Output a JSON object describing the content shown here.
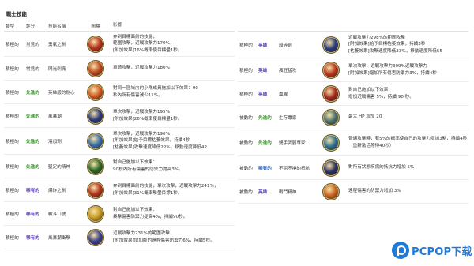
{
  "page_title": "戰士技能",
  "header": {
    "type": "類型",
    "rating": "評分",
    "name": "技能名稱",
    "icon": "圖標",
    "effect": "影響"
  },
  "colors": {
    "green": "#3a9a2a",
    "purple": "#5b3fb6",
    "blue": "#2f64c4"
  },
  "left_rows": [
    {
      "type": "積極的",
      "rating": "常見的",
      "rating_color": "default",
      "name": "勇氣之劍",
      "icon": "sword-slash-icon",
      "icon_color": "#b8321e",
      "lines": [
        "奔到目標面前的技能，",
        "範圍攻擊，近戰攻擊力170%，",
        "[附加效果]16%概率使目標暈1秒。"
      ]
    },
    {
      "type": "積極的",
      "rating": "常見的",
      "rating_color": "default",
      "name": "閃光刺痛",
      "icon": "flash-sting-icon",
      "icon_color": "#c0481f",
      "lines": [
        "單體攻擊，近戰攻擊力180%"
      ]
    },
    {
      "type": "積極的",
      "rating": "先進的",
      "rating_color": "green",
      "name": "英雄般的耐心",
      "icon": "heart-shield-icon",
      "icon_color": "#d25822",
      "lines": [
        "對同一區域內的小隊成員施加以下效果：90",
        "秒內所有傷害減少11%。"
      ]
    },
    {
      "type": "積極的",
      "rating": "先進的",
      "rating_color": "green",
      "name": "風暴潮",
      "icon": "storm-blade-icon",
      "icon_color": "#2c3b7a",
      "lines": [
        "單次攻擊，近戰攻擊力195%",
        "[附加效果]26%概率使目標暈1秒。"
      ]
    },
    {
      "type": "積極的",
      "rating": "先進的",
      "rating_color": "green",
      "name": "溶加劑",
      "icon": "whirl-icon",
      "icon_color": "#3a6fa8",
      "lines": [
        "單次攻擊，近戰攻擊力190%",
        "[附加效果]給予目標枯萎效果，持續4秒",
        "[枯萎效果]攻擊速度降低22%，移動速度降低42"
      ]
    },
    {
      "type": "積極的",
      "rating": "先進的",
      "rating_color": "green",
      "name": "堅定的精神",
      "icon": "spirit-icon",
      "icon_color": "#2d6b2a",
      "lines": [
        "對自己施加以下效果：",
        "90秒內所有傷害的防禦力提高3%。"
      ]
    },
    {
      "type": "積極的",
      "rating": "稀有的",
      "rating_color": "purple",
      "name": "爆炸之劍",
      "icon": "explosion-sword-icon",
      "icon_color": "#b5321c",
      "lines": [
        "奔到目標面前的技能，單次攻擊，近戰攻擊力241%，",
        "[附加效果]31%概率擊暈目標1秒。"
      ]
    },
    {
      "type": "積極的",
      "rating": "稀有的",
      "rating_color": "purple",
      "name": "戰斗口號",
      "icon": "battle-cry-icon",
      "icon_color": "#c99a22",
      "lines": [
        "對自己施加以下效果：",
        "暴擊傷害防禦力提高4%，持續90秒。"
      ]
    },
    {
      "type": "積極的",
      "rating": "稀有的",
      "rating_color": "purple",
      "name": "風暴潮衝擊",
      "icon": "storm-strike-icon",
      "icon_color": "#3b3f8a",
      "lines": [
        "近戰攻擊力231%的範圍攻擊",
        "[附加效果]增加鄰的遠程傷害防禦力6%，持續5秒。"
      ]
    }
  ],
  "right_rows": [
    {
      "type": "積極的",
      "rating": "英雄",
      "rating_color": "purple",
      "name": "殺碎劍",
      "icon": "shatter-blade-icon",
      "icon_color": "#2a3a7c",
      "lines": [
        "近戰攻擊力298%的範圍攻擊",
        "[附加效果]給予目標枯萎效果，持續3秒",
        "[枯萎效果]攻擊速度降低33%，移動速度降低55"
      ]
    },
    {
      "type": "積極的",
      "rating": "英雄",
      "rating_color": "purple",
      "name": "瘋狂猛攻",
      "icon": "frenzy-icon",
      "icon_color": "#b8361f",
      "lines": [
        "單次攻擊，近戰攻擊力309%近戰攻擊力",
        "[附加效果]增加所有傷害防禦力3%，持續4秒"
      ]
    },
    {
      "type": "積極的",
      "rating": "英雄",
      "rating_color": "purple",
      "name": "血腥",
      "icon": "blood-icon",
      "icon_color": "#a3261e",
      "lines": [
        "對自己施加以下效果：",
        "增加近戰傷害 5%，持續 90 秒。"
      ]
    },
    {
      "type": "被動的",
      "rating": "先進的",
      "rating_color": "green",
      "name": "生存專家",
      "icon": "survival-icon",
      "icon_color": "#4c6f6a",
      "lines": [
        "最大 HP 增加 20"
      ]
    },
    {
      "type": "被動的",
      "rating": "先進的",
      "rating_color": "green",
      "name": "雙手武器專家",
      "icon": "twin-weapon-icon",
      "icon_color": "#2e6e90",
      "lines": [
        "普通攻擊時，有5%的概率使自己的攻擊力增加3點，持續4秒",
        "（重新激活等待40秒）"
      ]
    },
    {
      "type": "被動的",
      "rating": "稀有的",
      "rating_color": "blue",
      "name": "不屈不撓的抵抗",
      "icon": "resist-icon",
      "icon_color": "#2a2f60",
      "lines": [
        "對所有狀態疾病的抵抗力增加 5%"
      ]
    },
    {
      "type": "被動的",
      "rating": "英雄",
      "rating_color": "purple",
      "name": "戰鬥精神",
      "icon": "fighting-spirit-icon",
      "icon_color": "#c8621e",
      "lines": [
        "遠程傷害的防禦力增加 3%"
      ]
    }
  ],
  "watermark": {
    "text": "PCPOP下载"
  }
}
